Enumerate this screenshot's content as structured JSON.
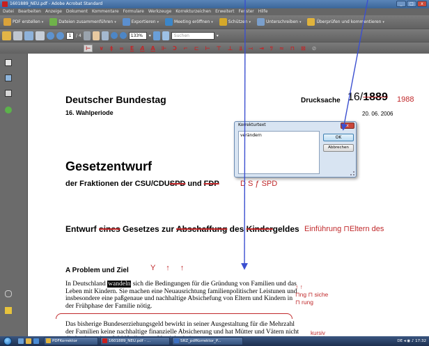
{
  "window": {
    "title": "1601889_NEU.pdf - Adobe Acrobat Standard",
    "min": "_",
    "max": "□",
    "close": "x"
  },
  "menu": [
    "Datei",
    "Bearbeiten",
    "Anzeige",
    "Dokument",
    "Kommentare",
    "Formulare",
    "Werkzeuge",
    "Korrekturzeichen",
    "Erweitert",
    "Fenster",
    "Hilfe"
  ],
  "toolbar1": {
    "create_pdf": "PDF erstellen",
    "combine": "Dateien zusammenführen",
    "export": "Exportieren",
    "meeting": "Meeting eröffnen",
    "protect": "Schützen",
    "sign": "Unterschreiben",
    "review": "Überprüfen und kommentieren"
  },
  "toolbar2": {
    "page_current": "1",
    "page_total": "/ 4",
    "zoom": "133%",
    "search_placeholder": "Suchen"
  },
  "proof_marks": [
    "⊢",
    "∨",
    "ǂ",
    "=",
    "E",
    "A",
    "A",
    "⊩",
    "Ↄ",
    "⌐",
    "⊏",
    "⊢",
    "⊤",
    "⊥",
    "⫫",
    "⤙",
    "⇥",
    "ﾂ",
    "≈",
    "⊓",
    "⊠",
    "⊘"
  ],
  "document": {
    "heading": "Deutscher Bundestag",
    "period": "16. Wahlperiode",
    "drucksache_label": "Drucksache",
    "drucksache_prefix": "16/",
    "drucksache_old": "1889",
    "drucksache_new": "1988",
    "date": "20. 06. 2006",
    "title": "Gesetzentwurf",
    "fraktionen_prefix": "der Fraktionen der CSU/CDU",
    "fraktionen_strike1": "SPD",
    "fraktionen_mid": " und ",
    "fraktionen_strike2": "FDP",
    "fraktionen_repl": "D  S  ƒ  SPD",
    "entwurf_p1": "Entwurf ",
    "entwurf_s1": "eines",
    "entwurf_p2": " Gesetzes zur ",
    "entwurf_s2": "Abschaffung",
    "entwurf_p3": " des ",
    "entwurf_s3": "Kinder",
    "entwurf_p4": "geldes",
    "entwurf_repl": "Einführung  ⊓Eltern  des",
    "problem": "A Problem und Ziel",
    "problem_marks": "Y ↑ ↑",
    "para1_a": "In Deutschland ",
    "para1_hl": "wandeln",
    "para1_b": " sich die Bedingungen für die Gründung von Familien und das Leben mit Kindern. Sie machen eine Neuausrichtung familienpolitischer Leistunen und insbesondere eine paßgenaue und nachhaltige Absichefung von Eltern und Kindern in der Frühphase der Familie nötig.",
    "margin1": "↑ ↑",
    "margin2": "⊓ng  ⊓ siche",
    "margin3": "⊓ rung",
    "para2": "Das bisherige Bundeserziehungsgeld bewirkt in seiner Ausgestaltung für die Mehrzahl der Familien keine nachhaltige finanzielle Absicherung und hat Mütter und Vätern nicht die hochwertigen Wahlfreiheit zur Vereinbarkeit",
    "kursiv": "kursiv"
  },
  "dialog": {
    "title": "Korrekturtext",
    "value": "verändern",
    "ok": "OK",
    "cancel": "Abbrechen",
    "close": "x"
  },
  "taskbar": {
    "task1": "PDFKorrektor",
    "task2": "1601889_NEU.pdf - ...",
    "task3": "SRZ_pdfKorrektor_P...",
    "tray": "DE  ◂  ◉  ♪  17:32"
  },
  "colors": {
    "proof_red": "#c0282a",
    "title_blue": "#3b6699",
    "toolbar_gray": "#6b6b6b"
  }
}
